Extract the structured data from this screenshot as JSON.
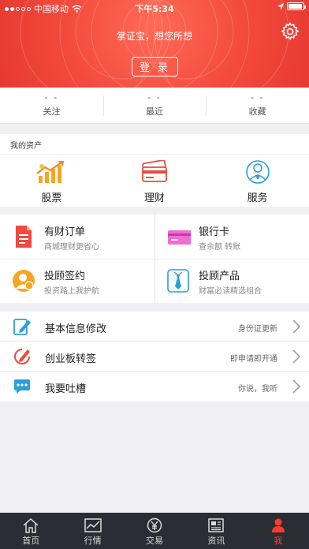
{
  "status_bar": {
    "carrier": "中国移动",
    "time": "下午5:34"
  },
  "header": {
    "slogan": "掌证宝，想您所想",
    "login_label": "登 录"
  },
  "stats": [
    {
      "value": "- -",
      "label": "关注"
    },
    {
      "value": "- -",
      "label": "最近"
    },
    {
      "value": "- -",
      "label": "收藏"
    }
  ],
  "assets": {
    "title": "我的资产",
    "items": [
      {
        "label": "股票",
        "icon": "stock-chart-icon"
      },
      {
        "label": "理财",
        "icon": "cards-icon"
      },
      {
        "label": "服务",
        "icon": "service-person-icon"
      }
    ]
  },
  "grid": [
    {
      "title": "有财订单",
      "subtitle": "商城理财更省心",
      "icon": "document-icon"
    },
    {
      "title": "银行卡",
      "subtitle": "查余额 转账",
      "icon": "bank-card-icon"
    },
    {
      "title": "投顾签约",
      "subtitle": "投资路上我护航",
      "icon": "advisor-avatar-icon"
    },
    {
      "title": "投顾产品",
      "subtitle": "财富必读精选组合",
      "icon": "tie-icon"
    }
  ],
  "list": [
    {
      "label": "基本信息修改",
      "hint": "身份证更新",
      "icon": "edit-icon"
    },
    {
      "label": "创业板转签",
      "hint": "即申请即开通",
      "icon": "sign-icon"
    },
    {
      "label": "我要吐槽",
      "hint": "你说，我听",
      "icon": "chat-icon"
    }
  ],
  "tabs": [
    {
      "label": "首页",
      "icon": "home-icon",
      "active": false
    },
    {
      "label": "行情",
      "icon": "market-chart-icon",
      "active": false
    },
    {
      "label": "交易",
      "icon": "yen-icon",
      "active": false
    },
    {
      "label": "资讯",
      "icon": "news-icon",
      "active": false
    },
    {
      "label": "我",
      "icon": "person-icon",
      "active": true
    }
  ],
  "colors": {
    "header_red": "#f24a3c",
    "tab_active": "#ff3b30",
    "tabbar_bg": "#2a2d33"
  }
}
